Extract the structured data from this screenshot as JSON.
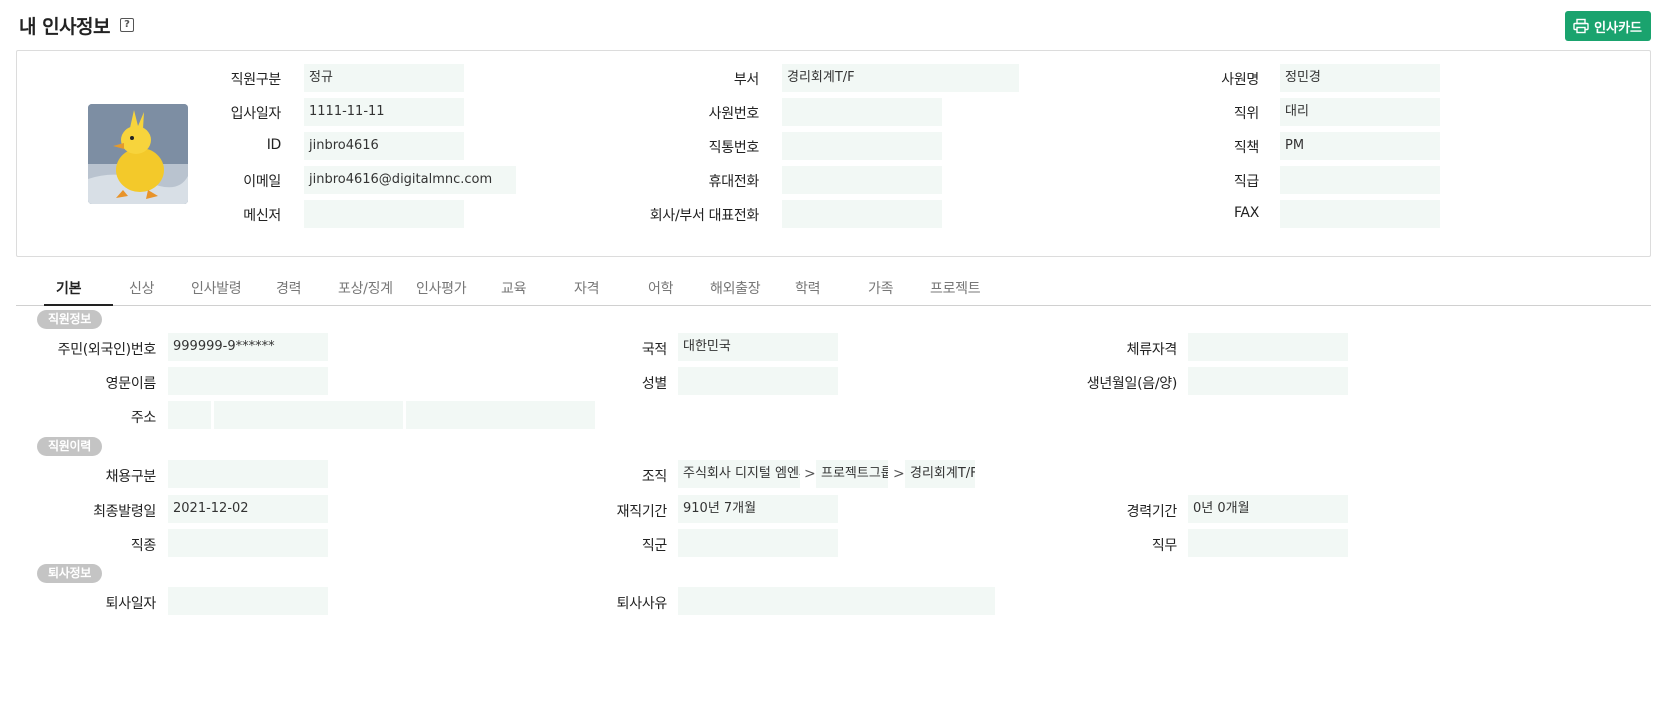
{
  "header": {
    "title": "내 인사정보",
    "help_icon": "question-box-icon",
    "card_button_label": "인사카드",
    "card_button_icon": "printer-icon",
    "accent_color": "#1aa36e"
  },
  "profile": {
    "employee_type_label": "직원구분",
    "employee_type": "정규",
    "hire_date_label": "입사일자",
    "hire_date": "1111-11-11",
    "id_label": "ID",
    "id": "jinbro4616",
    "email_label": "이메일",
    "email": "jinbro4616@digitalmnc.com",
    "messenger_label": "메신저",
    "messenger": "",
    "department_label": "부서",
    "department": "경리회계T/F",
    "employee_no_label": "사원번호",
    "employee_no": "",
    "direct_phone_label": "직통번호",
    "direct_phone": "",
    "mobile_label": "휴대전화",
    "mobile": "",
    "company_phone_label": "회사/부서 대표전화",
    "company_phone": "",
    "name_label": "사원명",
    "name": "정민경",
    "position_label": "직위",
    "position": "대리",
    "duty_label": "직책",
    "duty": "PM",
    "grade_label": "직급",
    "grade": "",
    "fax_label": "FAX",
    "fax": ""
  },
  "tabs": [
    "기본",
    "신상",
    "인사발령",
    "경력",
    "포상/징계",
    "인사평가",
    "교육",
    "자격",
    "어학",
    "해외출장",
    "학력",
    "가족",
    "프로젝트"
  ],
  "sections": {
    "employee_info": {
      "badge": "직원정보",
      "resident_no_label": "주민(외국인)번호",
      "resident_no": "999999-9******",
      "nationality_label": "국적",
      "nationality": "대한민국",
      "visa_label": "체류자격",
      "visa": "",
      "english_name_label": "영문이름",
      "english_name": "",
      "gender_label": "성별",
      "gender": "",
      "birth_label": "생년월일(음/양)",
      "birth": "",
      "address_label": "주소",
      "address_zip": "",
      "address_1": "",
      "address_2": ""
    },
    "employee_history": {
      "badge": "직원이력",
      "hire_type_label": "채용구분",
      "hire_type": "",
      "org_label": "조직",
      "org_path": [
        "주식회사 디지털 엠엔씨",
        "프로젝트그룹",
        "경리회계T/F"
      ],
      "org_separator": ">",
      "last_appoint_label": "최종발령일",
      "last_appoint": "2021-12-02",
      "tenure_label": "재직기간",
      "tenure": "910년 7개월",
      "career_label": "경력기간",
      "career": "0년 0개월",
      "job_type_label": "직종",
      "job_type": "",
      "job_group_label": "직군",
      "job_group": "",
      "job_label": "직무",
      "job": ""
    },
    "resignation": {
      "badge": "퇴사정보",
      "resign_date_label": "퇴사일자",
      "resign_date": "",
      "resign_reason_label": "퇴사사유",
      "resign_reason": ""
    }
  }
}
